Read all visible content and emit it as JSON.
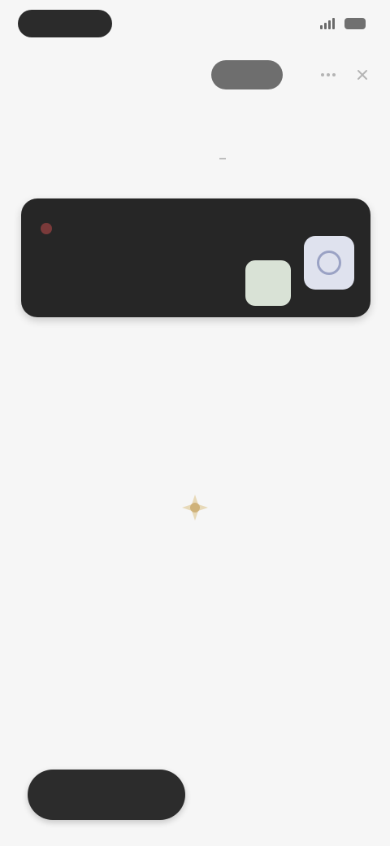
{
  "status_bar": {
    "time": "",
    "network": ""
  },
  "header": {
    "title": "",
    "pill_label": "",
    "icons": [
      "ellipsis-icon",
      "close-icon"
    ]
  },
  "tabs": [
    {
      "label": ""
    },
    {
      "label": ""
    }
  ],
  "card": {
    "title": "",
    "subtitle": "",
    "accent_color": "#7a3a3a"
  },
  "empty_state": {
    "icon": "star-icon",
    "icon_color": "#c9a86a",
    "message": ""
  },
  "actions": {
    "primary_label": "",
    "secondary_label": ""
  }
}
